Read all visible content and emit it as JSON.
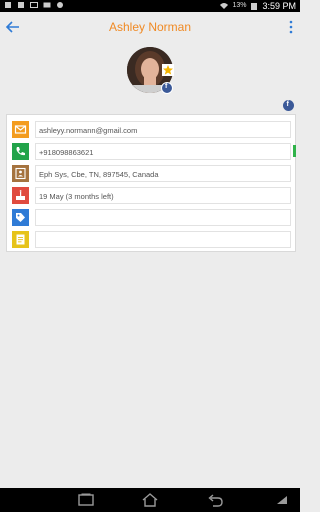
{
  "status_bar": {
    "signal": "13%",
    "time": "3:59 PM"
  },
  "header": {
    "title": "Ashley Norman"
  },
  "contact": {
    "email": "ashleyy.normann@gmail.com",
    "phone": "+918098863621",
    "address": "Eph Sys, Cbe, TN, 897545, Canada",
    "birthday": "19 May (3 months left)",
    "tags": "",
    "notes": ""
  },
  "social": {
    "facebook_glyph": "f"
  },
  "colors": {
    "accent": "#f08a24",
    "email_icon": "#f39c1f",
    "phone_icon": "#22a34a",
    "address_icon": "#a5733f",
    "birthday_icon": "#e04b3f",
    "tag_icon": "#2f7bd6",
    "note_icon": "#e6c31a",
    "facebook": "#3b5998"
  }
}
